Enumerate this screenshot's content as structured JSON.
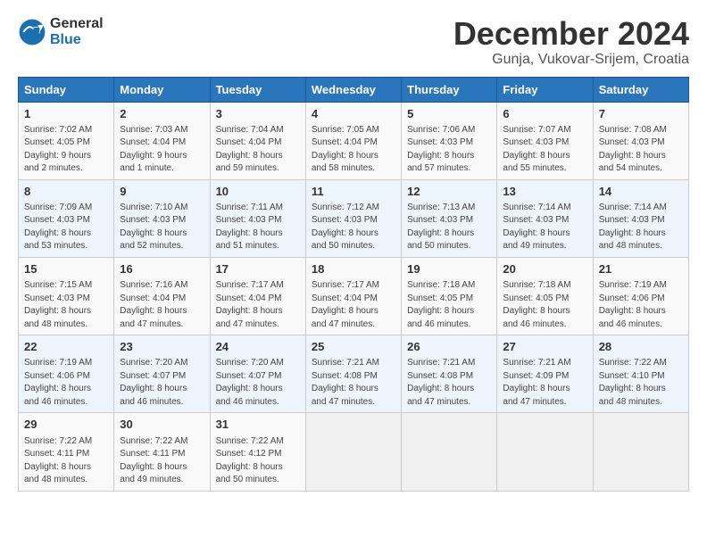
{
  "logo": {
    "general": "General",
    "blue": "Blue"
  },
  "header": {
    "title": "December 2024",
    "subtitle": "Gunja, Vukovar-Srijem, Croatia"
  },
  "weekdays": [
    "Sunday",
    "Monday",
    "Tuesday",
    "Wednesday",
    "Thursday",
    "Friday",
    "Saturday"
  ],
  "weeks": [
    [
      {
        "day": "1",
        "lines": [
          "Sunrise: 7:02 AM",
          "Sunset: 4:05 PM",
          "Daylight: 9 hours",
          "and 2 minutes."
        ]
      },
      {
        "day": "2",
        "lines": [
          "Sunrise: 7:03 AM",
          "Sunset: 4:04 PM",
          "Daylight: 9 hours",
          "and 1 minute."
        ]
      },
      {
        "day": "3",
        "lines": [
          "Sunrise: 7:04 AM",
          "Sunset: 4:04 PM",
          "Daylight: 8 hours",
          "and 59 minutes."
        ]
      },
      {
        "day": "4",
        "lines": [
          "Sunrise: 7:05 AM",
          "Sunset: 4:04 PM",
          "Daylight: 8 hours",
          "and 58 minutes."
        ]
      },
      {
        "day": "5",
        "lines": [
          "Sunrise: 7:06 AM",
          "Sunset: 4:03 PM",
          "Daylight: 8 hours",
          "and 57 minutes."
        ]
      },
      {
        "day": "6",
        "lines": [
          "Sunrise: 7:07 AM",
          "Sunset: 4:03 PM",
          "Daylight: 8 hours",
          "and 55 minutes."
        ]
      },
      {
        "day": "7",
        "lines": [
          "Sunrise: 7:08 AM",
          "Sunset: 4:03 PM",
          "Daylight: 8 hours",
          "and 54 minutes."
        ]
      }
    ],
    [
      {
        "day": "8",
        "lines": [
          "Sunrise: 7:09 AM",
          "Sunset: 4:03 PM",
          "Daylight: 8 hours",
          "and 53 minutes."
        ]
      },
      {
        "day": "9",
        "lines": [
          "Sunrise: 7:10 AM",
          "Sunset: 4:03 PM",
          "Daylight: 8 hours",
          "and 52 minutes."
        ]
      },
      {
        "day": "10",
        "lines": [
          "Sunrise: 7:11 AM",
          "Sunset: 4:03 PM",
          "Daylight: 8 hours",
          "and 51 minutes."
        ]
      },
      {
        "day": "11",
        "lines": [
          "Sunrise: 7:12 AM",
          "Sunset: 4:03 PM",
          "Daylight: 8 hours",
          "and 50 minutes."
        ]
      },
      {
        "day": "12",
        "lines": [
          "Sunrise: 7:13 AM",
          "Sunset: 4:03 PM",
          "Daylight: 8 hours",
          "and 50 minutes."
        ]
      },
      {
        "day": "13",
        "lines": [
          "Sunrise: 7:14 AM",
          "Sunset: 4:03 PM",
          "Daylight: 8 hours",
          "and 49 minutes."
        ]
      },
      {
        "day": "14",
        "lines": [
          "Sunrise: 7:14 AM",
          "Sunset: 4:03 PM",
          "Daylight: 8 hours",
          "and 48 minutes."
        ]
      }
    ],
    [
      {
        "day": "15",
        "lines": [
          "Sunrise: 7:15 AM",
          "Sunset: 4:03 PM",
          "Daylight: 8 hours",
          "and 48 minutes."
        ]
      },
      {
        "day": "16",
        "lines": [
          "Sunrise: 7:16 AM",
          "Sunset: 4:04 PM",
          "Daylight: 8 hours",
          "and 47 minutes."
        ]
      },
      {
        "day": "17",
        "lines": [
          "Sunrise: 7:17 AM",
          "Sunset: 4:04 PM",
          "Daylight: 8 hours",
          "and 47 minutes."
        ]
      },
      {
        "day": "18",
        "lines": [
          "Sunrise: 7:17 AM",
          "Sunset: 4:04 PM",
          "Daylight: 8 hours",
          "and 47 minutes."
        ]
      },
      {
        "day": "19",
        "lines": [
          "Sunrise: 7:18 AM",
          "Sunset: 4:05 PM",
          "Daylight: 8 hours",
          "and 46 minutes."
        ]
      },
      {
        "day": "20",
        "lines": [
          "Sunrise: 7:18 AM",
          "Sunset: 4:05 PM",
          "Daylight: 8 hours",
          "and 46 minutes."
        ]
      },
      {
        "day": "21",
        "lines": [
          "Sunrise: 7:19 AM",
          "Sunset: 4:06 PM",
          "Daylight: 8 hours",
          "and 46 minutes."
        ]
      }
    ],
    [
      {
        "day": "22",
        "lines": [
          "Sunrise: 7:19 AM",
          "Sunset: 4:06 PM",
          "Daylight: 8 hours",
          "and 46 minutes."
        ]
      },
      {
        "day": "23",
        "lines": [
          "Sunrise: 7:20 AM",
          "Sunset: 4:07 PM",
          "Daylight: 8 hours",
          "and 46 minutes."
        ]
      },
      {
        "day": "24",
        "lines": [
          "Sunrise: 7:20 AM",
          "Sunset: 4:07 PM",
          "Daylight: 8 hours",
          "and 46 minutes."
        ]
      },
      {
        "day": "25",
        "lines": [
          "Sunrise: 7:21 AM",
          "Sunset: 4:08 PM",
          "Daylight: 8 hours",
          "and 47 minutes."
        ]
      },
      {
        "day": "26",
        "lines": [
          "Sunrise: 7:21 AM",
          "Sunset: 4:08 PM",
          "Daylight: 8 hours",
          "and 47 minutes."
        ]
      },
      {
        "day": "27",
        "lines": [
          "Sunrise: 7:21 AM",
          "Sunset: 4:09 PM",
          "Daylight: 8 hours",
          "and 47 minutes."
        ]
      },
      {
        "day": "28",
        "lines": [
          "Sunrise: 7:22 AM",
          "Sunset: 4:10 PM",
          "Daylight: 8 hours",
          "and 48 minutes."
        ]
      }
    ],
    [
      {
        "day": "29",
        "lines": [
          "Sunrise: 7:22 AM",
          "Sunset: 4:11 PM",
          "Daylight: 8 hours",
          "and 48 minutes."
        ]
      },
      {
        "day": "30",
        "lines": [
          "Sunrise: 7:22 AM",
          "Sunset: 4:11 PM",
          "Daylight: 8 hours",
          "and 49 minutes."
        ]
      },
      {
        "day": "31",
        "lines": [
          "Sunrise: 7:22 AM",
          "Sunset: 4:12 PM",
          "Daylight: 8 hours",
          "and 50 minutes."
        ]
      },
      {
        "day": "",
        "lines": []
      },
      {
        "day": "",
        "lines": []
      },
      {
        "day": "",
        "lines": []
      },
      {
        "day": "",
        "lines": []
      }
    ]
  ]
}
